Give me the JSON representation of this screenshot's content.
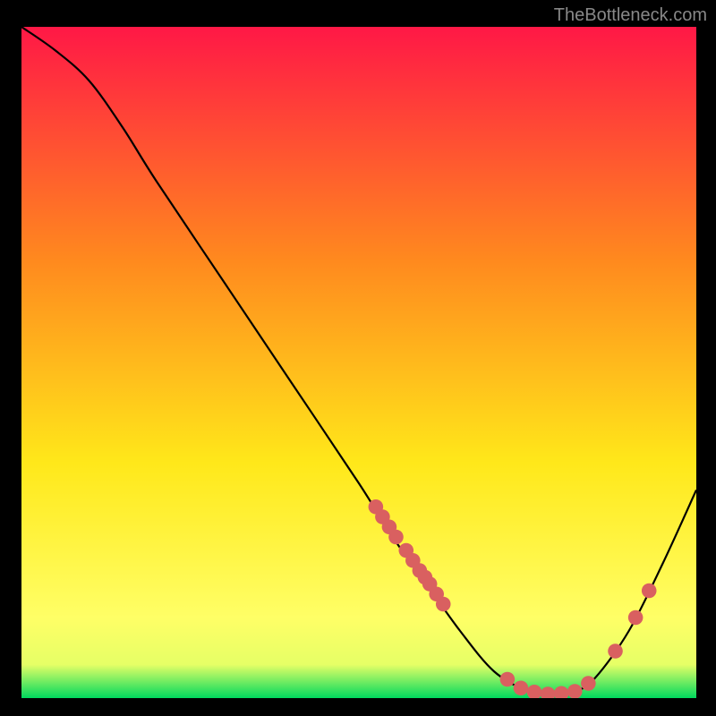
{
  "watermark": "TheBottleneck.com",
  "chart_data": {
    "type": "line",
    "title": "",
    "xlabel": "",
    "ylabel": "",
    "xlim": [
      0,
      100
    ],
    "ylim": [
      0,
      100
    ],
    "curve": [
      {
        "x": 0,
        "y": 100
      },
      {
        "x": 5,
        "y": 96.5
      },
      {
        "x": 10,
        "y": 92
      },
      {
        "x": 15,
        "y": 85
      },
      {
        "x": 20,
        "y": 77
      },
      {
        "x": 30,
        "y": 62
      },
      {
        "x": 40,
        "y": 47
      },
      {
        "x": 50,
        "y": 32
      },
      {
        "x": 55,
        "y": 24
      },
      {
        "x": 60,
        "y": 17
      },
      {
        "x": 65,
        "y": 10
      },
      {
        "x": 70,
        "y": 4
      },
      {
        "x": 75,
        "y": 1
      },
      {
        "x": 78,
        "y": 0.5
      },
      {
        "x": 82,
        "y": 1
      },
      {
        "x": 85,
        "y": 3
      },
      {
        "x": 90,
        "y": 10
      },
      {
        "x": 95,
        "y": 20
      },
      {
        "x": 100,
        "y": 31
      }
    ],
    "scatter_points": [
      {
        "x": 52.5,
        "y": 28.5
      },
      {
        "x": 53.5,
        "y": 27
      },
      {
        "x": 54.5,
        "y": 25.5
      },
      {
        "x": 55.5,
        "y": 24
      },
      {
        "x": 57,
        "y": 22
      },
      {
        "x": 58,
        "y": 20.5
      },
      {
        "x": 59,
        "y": 19
      },
      {
        "x": 59.8,
        "y": 18
      },
      {
        "x": 60.5,
        "y": 17
      },
      {
        "x": 61.5,
        "y": 15.5
      },
      {
        "x": 62.5,
        "y": 14
      },
      {
        "x": 72,
        "y": 2.8
      },
      {
        "x": 74,
        "y": 1.5
      },
      {
        "x": 76,
        "y": 0.9
      },
      {
        "x": 78,
        "y": 0.6
      },
      {
        "x": 80,
        "y": 0.7
      },
      {
        "x": 82,
        "y": 1
      },
      {
        "x": 84,
        "y": 2.2
      },
      {
        "x": 88,
        "y": 7
      },
      {
        "x": 91,
        "y": 12
      },
      {
        "x": 93,
        "y": 16
      }
    ],
    "gradient_stops": [
      {
        "offset": 0,
        "color": "#ff1846"
      },
      {
        "offset": 0.35,
        "color": "#ff8a1e"
      },
      {
        "offset": 0.65,
        "color": "#ffe81a"
      },
      {
        "offset": 0.88,
        "color": "#ffff66"
      },
      {
        "offset": 0.95,
        "color": "#e6ff66"
      },
      {
        "offset": 1,
        "color": "#00d95e"
      }
    ],
    "curve_color": "#000000",
    "point_color": "#d96060",
    "point_radius_data_units": 1.1
  }
}
